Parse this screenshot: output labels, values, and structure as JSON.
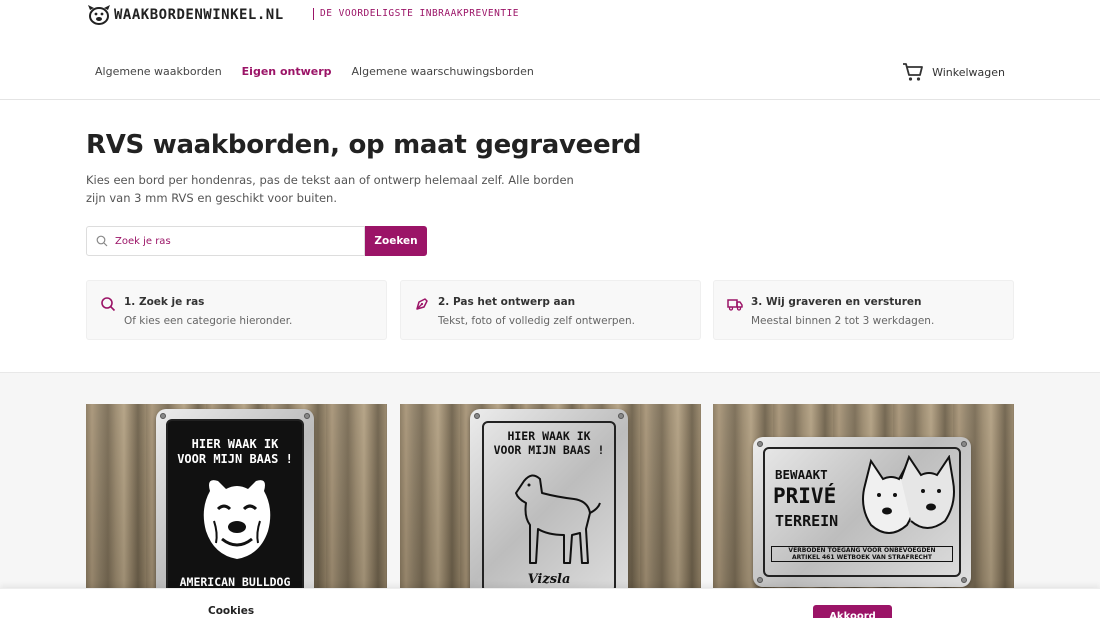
{
  "brand": {
    "name": "WAAKBORDENWINKEL.NL",
    "tagline": "DE VOORDELIGSTE INBRAAKPREVENTIE",
    "logo_icon": "dog-face-icon",
    "accent_color": "#9b1467"
  },
  "nav": {
    "items": [
      {
        "label": "Algemene waakborden",
        "active": false
      },
      {
        "label": "Eigen ontwerp",
        "active": true
      },
      {
        "label": "Algemene waarschuwingsborden",
        "active": false
      }
    ],
    "cart_label": "Winkelwagen",
    "cart_icon": "cart-icon"
  },
  "hero": {
    "title": "RVS waakborden, op maat gegraveerd",
    "subtitle": "Kies een bord per hondenras, pas de tekst aan of ontwerp helemaal zelf. Alle borden zijn van 3 mm RVS en geschikt voor buiten."
  },
  "search": {
    "placeholder": "Zoek je ras",
    "button_label": "Zoeken",
    "icon": "search-icon"
  },
  "steps": [
    {
      "icon": "search-icon",
      "title": "1. Zoek je ras",
      "description": "Of kies een categorie hieronder."
    },
    {
      "icon": "pen-tool-icon",
      "title": "2. Pas het ontwerp aan",
      "description": "Tekst, foto of volledig zelf ontwerpen."
    },
    {
      "icon": "truck-icon",
      "title": "3. Wij graveren en versturen",
      "description": "Meestal binnen 2 tot 3 werkdagen."
    }
  ],
  "products": [
    {
      "header": [
        "HIER WAAK IK",
        "VOOR MIJN BAAS !"
      ],
      "footer": "AMERICAN BULLDOG"
    },
    {
      "header": [
        "HIER WAAK IK",
        "VOOR MIJN BAAS !"
      ],
      "footer": "Vizsla"
    },
    {
      "lines": [
        "BEWAAKT",
        "PRIVÉ",
        "TERREIN"
      ],
      "notice": [
        "VERBODEN TOEGANG VOOR ONBEVOEGDEN",
        "ARTIKEL 461 WETBOEK VAN STRAFRECHT"
      ]
    }
  ],
  "cookie": {
    "title": "Cookies",
    "button_label": "Akkoord"
  }
}
